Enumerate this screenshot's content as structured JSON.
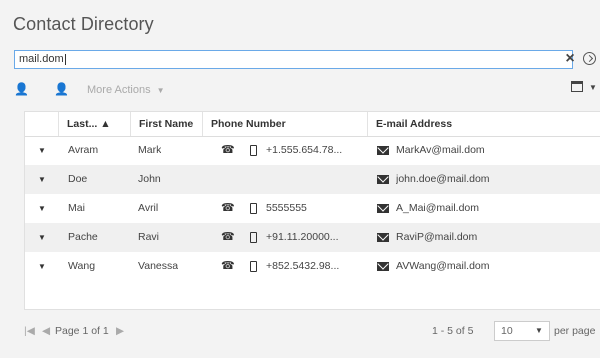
{
  "title": "Contact Directory",
  "search": {
    "value": "mail.dom"
  },
  "icons": {
    "clear": "close-icon",
    "options": "chevron-circle-icon",
    "add_contact": "add-user-icon",
    "remove_contact": "remove-user-icon",
    "columns": "window-icon",
    "phone": "phone-icon",
    "mobile": "mobile-icon",
    "email": "envelope-icon",
    "expand": "caret-down-icon"
  },
  "toolbar": {
    "more_actions": "More Actions"
  },
  "table": {
    "headers": [
      "Last...",
      "First Name",
      "Phone Number",
      "E-mail Address"
    ],
    "sort_indicator": "–",
    "rows": [
      {
        "last": "Avram",
        "first": "Mark",
        "phone": "+1.555.654.78...",
        "email": "MarkAv@mail.dom"
      },
      {
        "last": "Doe",
        "first": "John",
        "phone": "",
        "email": "john.doe@mail.dom"
      },
      {
        "last": "Mai",
        "first": "Avril",
        "phone": "5555555",
        "email": "A_Mai@mail.dom"
      },
      {
        "last": "Pache",
        "first": "Ravi",
        "phone": "+91.11.20000...",
        "email": "RaviP@mail.dom"
      },
      {
        "last": "Wang",
        "first": "Vanessa",
        "phone": "+852.5432.98...",
        "email": "AVWang@mail.dom"
      }
    ]
  },
  "pager": {
    "page_label": "Page 1 of 1",
    "range": "1 - 5 of 5",
    "page_size": "10",
    "per_page": "per page"
  }
}
